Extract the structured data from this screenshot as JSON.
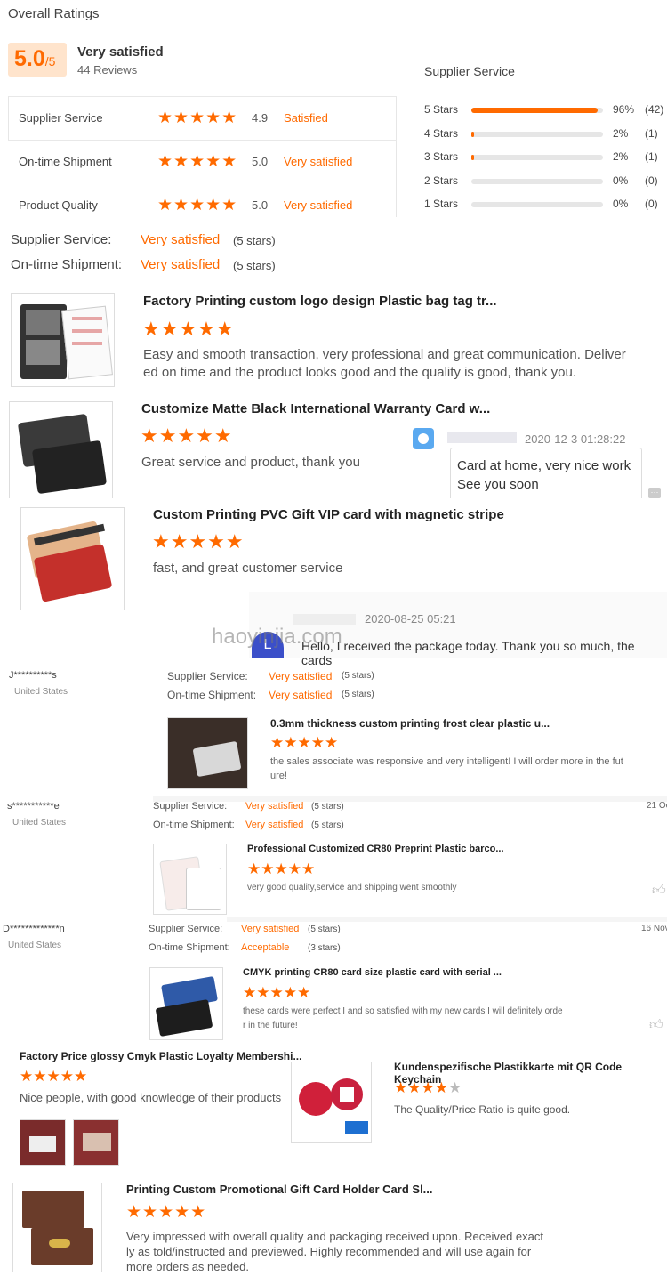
{
  "overall": {
    "heading": "Overall Ratings",
    "score": "5.0",
    "score_suffix": "/5",
    "summary": "Very satisfied",
    "reviews": "44 Reviews",
    "rows": [
      {
        "label": "Supplier Service",
        "score": "4.9",
        "text": "Satisfied",
        "stars": 5
      },
      {
        "label": "On-time Shipment",
        "score": "5.0",
        "text": "Very satisfied",
        "stars": 5
      },
      {
        "label": "Product Quality",
        "score": "5.0",
        "text": "Very satisfied",
        "stars": 5
      }
    ]
  },
  "breakdown": {
    "title": "Supplier Service",
    "rows": [
      {
        "label": "5 Stars",
        "pct": "96%",
        "count": "(42)",
        "fraction": 0.96
      },
      {
        "label": "4 Stars",
        "pct": "2%",
        "count": "(1)",
        "fraction": 0.02
      },
      {
        "label": "3 Stars",
        "pct": "2%",
        "count": "(1)",
        "fraction": 0.02
      },
      {
        "label": "2 Stars",
        "pct": "0%",
        "count": "(0)",
        "fraction": 0
      },
      {
        "label": "1 Stars",
        "pct": "0%",
        "count": "(0)",
        "fraction": 0
      }
    ]
  },
  "summary_lines": [
    {
      "label": "Supplier Service:",
      "value": "Very satisfied",
      "stars": "(5 stars)"
    },
    {
      "label": "On-time Shipment:",
      "value": "Very satisfied",
      "stars": "(5 stars)"
    }
  ],
  "reviews_large": [
    {
      "title": "Factory Printing custom logo design Plastic bag tag tr...",
      "text1": "Easy and smooth transaction, very professional and great communication. Deliver",
      "text2": "ed on time and the product looks good and the quality is good, thank you."
    },
    {
      "title": "Customize Matte Black International Warranty Card w...",
      "text1": "Great service and product, thank you"
    },
    {
      "title": "Custom Printing PVC Gift VIP card with magnetic stripe",
      "text1": "fast, and great customer service"
    }
  ],
  "reply1": {
    "date": "2020-12-3 01:28:22",
    "line1": "Card at home, very nice work",
    "line2": "See you soon"
  },
  "reply2": {
    "date": "2020-08-25 05:21",
    "text": "Hello, I received the package today. Thank you so much, the cards",
    "avatar": "L",
    "watermark": "haoyinjia.com"
  },
  "reviewers": [
    {
      "name": "J**********s",
      "country": "United States",
      "ss_label": "Supplier Service:",
      "ss_value": "Very satisfied",
      "ss_stars": "(5 stars)",
      "os_label": "On-time Shipment:",
      "os_value": "Very satisfied",
      "os_stars": "(5 stars)",
      "product": "0.3mm thickness custom printing frost clear plastic u...",
      "text1": "the sales associate was responsive and very intelligent! I will order more in the fut",
      "text2": "ure!"
    },
    {
      "name": "s***********e",
      "country": "United States",
      "date": "21 Oc",
      "ss_label": "Supplier Service:",
      "ss_value": "Very satisfied",
      "ss_stars": "(5 stars)",
      "os_label": "On-time Shipment:",
      "os_value": "Very satisfied",
      "os_stars": "(5 stars)",
      "product": "Professional Customized CR80 Preprint Plastic barco...",
      "text1": "very good quality,service and shipping went smoothly"
    },
    {
      "name": "D*************n",
      "country": "United States",
      "date": "16 Nov",
      "ss_label": "Supplier Service:",
      "ss_value": "Very satisfied",
      "ss_stars": "(5 stars)",
      "os_label": "On-time Shipment:",
      "os_value": "Acceptable",
      "os_stars": "(3 stars)",
      "product": "CMYK printing CR80 card size plastic card with serial ...",
      "text1": "these cards were perfect I and so satisfied with my new cards I will definitely orde",
      "text2": "r in the future!"
    }
  ],
  "bottom_left": {
    "title": "Factory Price glossy Cmyk Plastic Loyalty Membershi...",
    "text": "Nice people, with good knowledge of their products",
    "stars": 5
  },
  "bottom_right": {
    "title": "Kundenspezifische Plastikkarte mit QR Code Keychain",
    "text": "The Quality/Price Ratio is quite good.",
    "stars": 4
  },
  "last": {
    "title": "Printing Custom Promotional Gift Card Holder Card Sl...",
    "text1": "Very impressed with overall quality and packaging received upon.  Received exact",
    "text2": "ly as told/instructed and previewed.  Highly recommended and will use again for",
    "text3": "more orders as needed."
  },
  "colors": {
    "accent": "#ff6a00",
    "badge_bg": "#ffe4cc"
  }
}
